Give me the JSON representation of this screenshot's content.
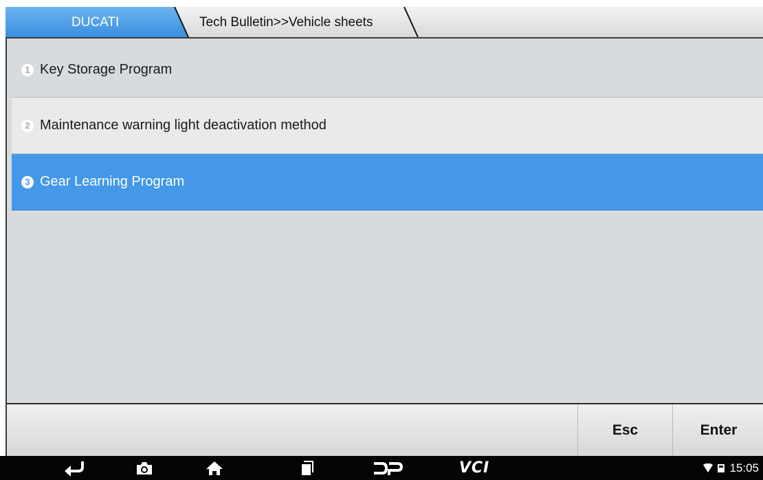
{
  "header": {
    "brand": "DUCATI",
    "breadcrumb": "Tech Bulletin>>Vehicle sheets"
  },
  "list": {
    "items": [
      {
        "number": "1",
        "label": "Key Storage Program",
        "selected": false
      },
      {
        "number": "2",
        "label": "Maintenance warning light deactivation method",
        "selected": false
      },
      {
        "number": "3",
        "label": "Gear Learning Program",
        "selected": true
      }
    ]
  },
  "actions": {
    "esc_label": "Esc",
    "enter_label": "Enter"
  },
  "system_bar": {
    "icons": [
      "back-icon",
      "camera-icon",
      "home-icon",
      "recent-apps-icon",
      "dp-icon",
      "vci-icon"
    ],
    "vci_label": "VCI",
    "time": "15:05"
  },
  "colors": {
    "accent": "#4498e7",
    "panel_bg": "#d7dbde",
    "alt_row_bg": "#eaeaea",
    "system_bar_bg": "#050505"
  }
}
